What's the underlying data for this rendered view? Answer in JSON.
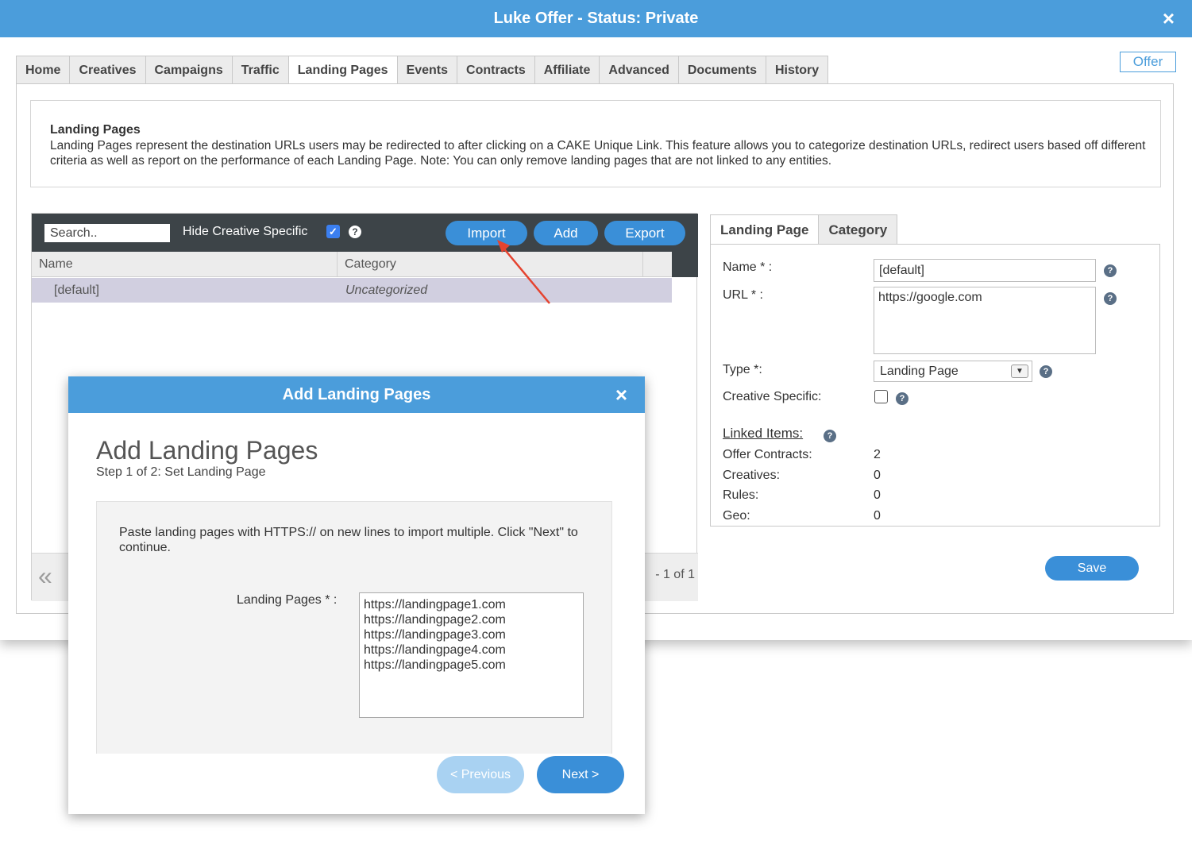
{
  "window": {
    "title": "Luke Offer - Status: Private",
    "close_icon": "×"
  },
  "tabs": [
    {
      "label": "Home"
    },
    {
      "label": "Creatives"
    },
    {
      "label": "Campaigns"
    },
    {
      "label": "Traffic"
    },
    {
      "label": "Landing Pages",
      "active": true
    },
    {
      "label": "Events"
    },
    {
      "label": "Contracts"
    },
    {
      "label": "Affiliate"
    },
    {
      "label": "Advanced"
    },
    {
      "label": "Documents"
    },
    {
      "label": "History"
    }
  ],
  "offer_button": "Offer",
  "info": {
    "title": "Landing Pages",
    "text": "Landing Pages represent the destination URLs users may be redirected to after clicking on a CAKE Unique Link. This feature allows you to categorize destination URLs, redirect users based off different criteria as well as report on the performance of each Landing Page. Note: You can only remove landing pages that are not linked to any entities."
  },
  "toolbar": {
    "search_placeholder": "Search..",
    "hide_creative_specific_label": "Hide Creative Specific",
    "hide_creative_specific_checked": true,
    "help_glyph": "?",
    "import_label": "Import",
    "add_label": "Add",
    "export_label": "Export"
  },
  "grid": {
    "columns": [
      "Name",
      "Category"
    ],
    "rows": [
      {
        "name": "[default]",
        "category": "Uncategorized"
      }
    ]
  },
  "pager": {
    "prev_glyph": "«",
    "text": "- 1 of 1"
  },
  "detail": {
    "tabs": [
      {
        "label": "Landing Page",
        "active": true
      },
      {
        "label": "Category"
      }
    ],
    "name_label": "Name * :",
    "name_value": "[default]",
    "url_label": "URL * :",
    "url_value": "https://google.com",
    "type_label": "Type *:",
    "type_value": "Landing Page",
    "creative_specific_label": "Creative Specific:",
    "creative_specific_checked": false,
    "linked_items_label": "Linked Items:",
    "linked": [
      {
        "label": "Offer Contracts:",
        "value": "2"
      },
      {
        "label": "Creatives:",
        "value": "0"
      },
      {
        "label": "Rules:",
        "value": "0"
      },
      {
        "label": "Geo:",
        "value": "0"
      }
    ],
    "save_label": "Save"
  },
  "modal": {
    "title": "Add Landing Pages",
    "close_icon": "×",
    "heading": "Add Landing Pages",
    "step": "Step 1 of 2: Set Landing Page",
    "instructions": "Paste landing pages with HTTPS:// on new lines to import multiple. Click \"Next\" to continue.",
    "field_label": "Landing Pages * :",
    "field_value": "https://landingpage1.com\nhttps://landingpage2.com\nhttps://landingpage3.com\nhttps://landingpage4.com\nhttps://landingpage5.com",
    "prev_label": "< Previous",
    "next_label": "Next >"
  },
  "colors": {
    "titlebar": "#4b9ddb",
    "button_blue": "#3a8fd8",
    "toolbar_dark": "#3d4448",
    "selected_row": "#d1cfe0",
    "arrow_red": "#e5432f"
  }
}
